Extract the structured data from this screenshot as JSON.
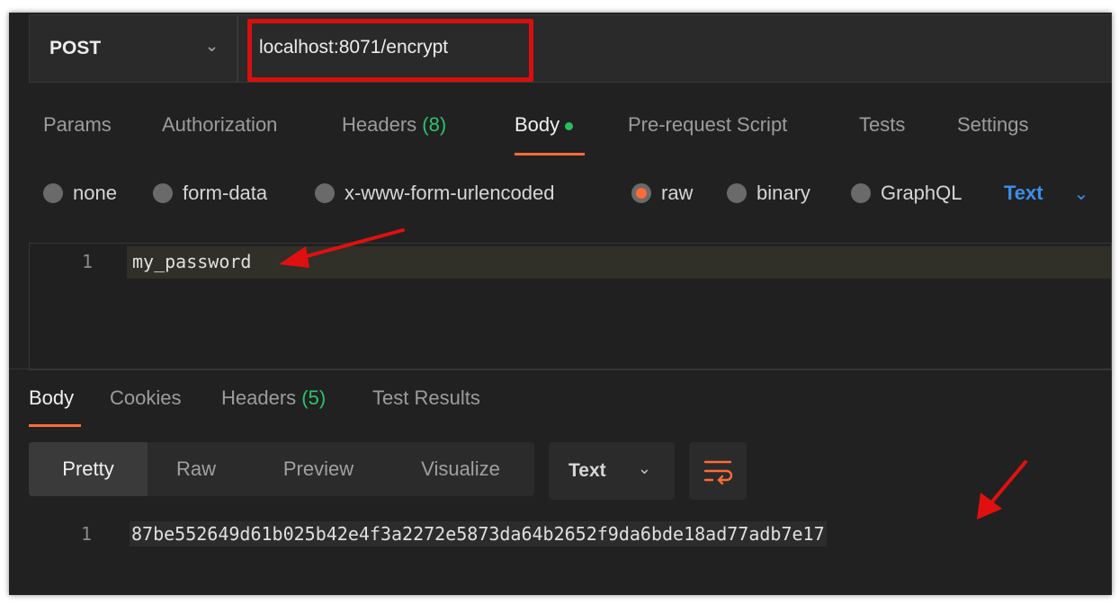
{
  "request": {
    "method": "POST",
    "url": "localhost:8071/encrypt"
  },
  "request_tabs": [
    {
      "label": "Params"
    },
    {
      "label": "Authorization"
    },
    {
      "label": "Headers",
      "count": "(8)"
    },
    {
      "label": "Body",
      "active": true,
      "has_dot": true
    },
    {
      "label": "Pre-request Script"
    },
    {
      "label": "Tests"
    },
    {
      "label": "Settings"
    }
  ],
  "body_types": [
    {
      "label": "none",
      "selected": false
    },
    {
      "label": "form-data",
      "selected": false
    },
    {
      "label": "x-www-form-urlencoded",
      "selected": false
    },
    {
      "label": "raw",
      "selected": true
    },
    {
      "label": "binary",
      "selected": false
    },
    {
      "label": "GraphQL",
      "selected": false
    }
  ],
  "raw_format": "Text",
  "editor": {
    "line_number": "1",
    "content": "my_password"
  },
  "response_tabs": [
    {
      "label": "Body",
      "active": true
    },
    {
      "label": "Cookies"
    },
    {
      "label": "Headers",
      "count": "(5)"
    },
    {
      "label": "Test Results"
    }
  ],
  "view_modes": [
    "Pretty",
    "Raw",
    "Preview",
    "Visualize"
  ],
  "response_format": "Text",
  "response": {
    "line_number": "1",
    "content": "87be552649d61b025b42e4f3a2272e5873da64b2652f9da6bde18ad77adb7e17"
  },
  "colors": {
    "accent": "#ff6c37",
    "highlight_box": "#d80f0f",
    "count_green": "#2ec26a",
    "link_blue": "#3c8ee9"
  }
}
